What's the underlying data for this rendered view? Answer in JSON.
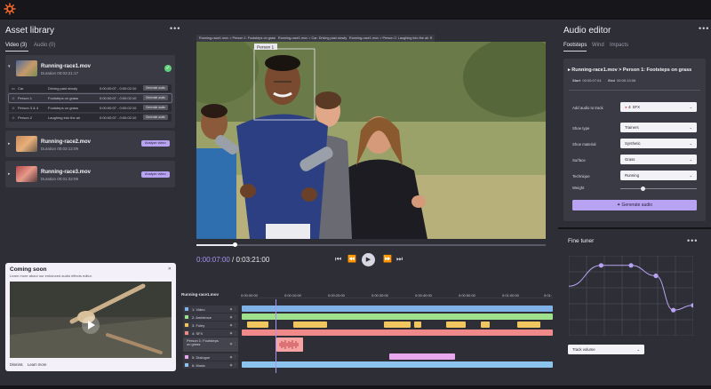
{
  "left": {
    "title": "Asset library",
    "tabs": [
      {
        "label": "Video (3)"
      },
      {
        "label": "Audio (0)"
      }
    ],
    "cards": [
      {
        "name": "Running-race1.mov",
        "duration": "Duration 00:03:21:17"
      },
      {
        "name": "Running-race2.mov",
        "duration": "Duration 00:03:12:09",
        "action": "Analyze video"
      },
      {
        "name": "Running-race3.mov",
        "duration": "Duration 00:01:32:09",
        "action": "Analyze video"
      }
    ],
    "detections": [
      {
        "label": "Car",
        "desc": "Driving past slowly",
        "range": "0:00:00:07 - 0:00:02:10",
        "action": "Generate audio"
      },
      {
        "label": "Person 1",
        "desc": "Footsteps on grass",
        "range": "0:00:00:07 - 0:00:02:10",
        "action": "Generate audio"
      },
      {
        "label": "Person 3 & 4",
        "desc": "Footsteps on grass",
        "range": "0:00:00:07 - 0:00:02:10",
        "action": "Generate audio"
      },
      {
        "label": "Person 2",
        "desc": "Laughing into the air",
        "range": "0:00:00:07 - 0:00:02:10",
        "action": "Generate audio"
      }
    ],
    "coming": {
      "title": "Coming soon",
      "subtitle": "Learn more about our enhanced audio effects editor.",
      "dismiss": "Dismiss",
      "learn": "Learn more"
    }
  },
  "center": {
    "video_tabs": [
      {
        "label": "Running-race1.mov > Person 1: Footsteps on grass"
      },
      {
        "label": "Running-race1.mov > Car: Driving past slowly"
      },
      {
        "label": "Running-race1.mov > Person 2: Laughing into the air"
      }
    ],
    "box_label": "Person 1",
    "time_current": "0:00:07:00",
    "time_total": "/ 0:03:21:00",
    "progress": 0.11
  },
  "timeline": {
    "file": "Running-race1.mov",
    "ruler": [
      "0:00:00:00",
      "0:00:10:00",
      "0:00:20:00",
      "0:00:30:00",
      "0:00:40:00",
      "0:00:50:00",
      "0:01:00:00",
      "0:01:"
    ],
    "tracks": [
      {
        "label": "1: Video",
        "color": "#7fb3e8"
      },
      {
        "label": "2: Ambience",
        "color": "#9ee08c"
      },
      {
        "label": "3: Foley",
        "color": "#f2c65e"
      },
      {
        "label": "4: SFX",
        "color": "#f08a8a"
      },
      {
        "label": "Person 1: Footsteps on grass",
        "color": "#f5a3a3"
      },
      {
        "label": "5: Dialogue",
        "color": "#e8a8ee"
      },
      {
        "label": "6: Music",
        "color": "#8cc4ee"
      }
    ]
  },
  "audio": {
    "title": "Audio editor",
    "tabs": [
      {
        "label": "Footsteps"
      },
      {
        "label": "Wind"
      },
      {
        "label": "Impacts"
      }
    ],
    "clip_title": "Running-race1.mov > Person 1: Footsteps on grass",
    "start_label": "Start",
    "start": "00:00:07:04",
    "end_label": "End",
    "end": "00:00:13:06",
    "fields": [
      {
        "label": "Add audio to track",
        "value": "4: SFX"
      },
      {
        "label": "Shoe type",
        "value": "Trainers"
      },
      {
        "label": "Shoe material",
        "value": "Synthetic"
      },
      {
        "label": "Surface",
        "value": "Grass"
      },
      {
        "label": "Technique",
        "value": "Running"
      }
    ],
    "weight_label": "Weight",
    "weight": 0.3,
    "generate": "Generate audio"
  },
  "tuner": {
    "title": "Fine tuner",
    "points": [
      0.62,
      0.88,
      0.88,
      0.75,
      0.32,
      0.38
    ],
    "dropdown": "Track volume"
  },
  "colors": {
    "accent": "#b8a3f2",
    "panel": "#2e2e37",
    "playhead": "#a893f0"
  }
}
